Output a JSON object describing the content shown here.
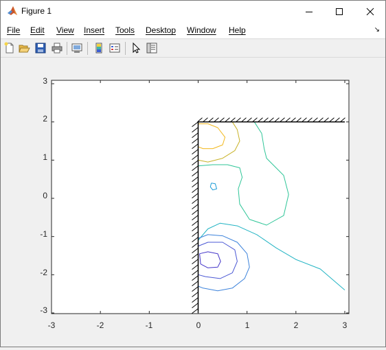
{
  "window": {
    "title": "Figure 1",
    "controls": [
      "minimize",
      "maximize",
      "close"
    ]
  },
  "menu": {
    "items": [
      "File",
      "Edit",
      "View",
      "Insert",
      "Tools",
      "Desktop",
      "Window",
      "Help"
    ]
  },
  "toolbar": {
    "icons": [
      "new-figure-icon",
      "open-file-icon",
      "save-icon",
      "print-icon",
      "link-plot-icon",
      "insert-colorbar-icon",
      "insert-legend-icon",
      "edit-plot-icon",
      "property-inspector-icon"
    ]
  },
  "chart_data": {
    "type": "contour",
    "title": "",
    "xlabel": "",
    "ylabel": "",
    "xlim": [
      -3,
      3
    ],
    "ylim": [
      -3,
      3
    ],
    "xticks": [
      "-3",
      "-2",
      "-1",
      "0",
      "1",
      "2",
      "3"
    ],
    "yticks": [
      "3",
      "2",
      "1",
      "0",
      "-1",
      "-2",
      "-3"
    ],
    "grid": false,
    "walls": [
      {
        "name": "left-wall",
        "x": [
          0,
          0
        ],
        "y": [
          -3,
          2
        ]
      },
      {
        "name": "top-wall",
        "x": [
          0,
          3
        ],
        "y": [
          2,
          2
        ]
      }
    ],
    "contours": [
      {
        "name": "positive-inner",
        "color": "#f2b81b",
        "x": [
          0,
          0.2,
          0.4,
          0.55,
          0.5,
          0.3,
          0.1,
          0
        ],
        "y": [
          1.95,
          1.95,
          1.85,
          1.6,
          1.4,
          1.3,
          1.3,
          1.35
        ]
      },
      {
        "name": "positive-outer",
        "color": "#c8b227",
        "x": [
          0.7,
          0.8,
          0.85,
          0.75,
          0.5,
          0.2,
          0
        ],
        "y": [
          2,
          1.8,
          1.5,
          1.25,
          1.05,
          0.95,
          1.0
        ]
      },
      {
        "name": "zero-level",
        "color": "#2dc597",
        "x": [
          1.15,
          1.3,
          1.35,
          1.4,
          1.75,
          1.85,
          1.75,
          1.4,
          1.05,
          0.85,
          0.82,
          0.9,
          0.85,
          0.6,
          0.3,
          0
        ],
        "y": [
          2,
          1.7,
          1.3,
          1.05,
          0.6,
          0.1,
          -0.45,
          -0.7,
          -0.55,
          -0.15,
          0.25,
          0.55,
          0.8,
          0.88,
          0.88,
          0.85
        ]
      },
      {
        "name": "island",
        "color": "#1a9bd6",
        "x": [
          0.27,
          0.35,
          0.38,
          0.3,
          0.25,
          0.27
        ],
        "y": [
          0.4,
          0.38,
          0.25,
          0.22,
          0.3,
          0.4
        ]
      },
      {
        "name": "negative-long",
        "color": "#20b3c3",
        "x": [
          0,
          0.2,
          0.45,
          0.8,
          1.2,
          1.6,
          2.0,
          2.5,
          3.0
        ],
        "y": [
          -1.1,
          -0.8,
          -0.65,
          -0.72,
          -0.95,
          -1.3,
          -1.6,
          -1.85,
          -2.4
        ]
      },
      {
        "name": "negative-outer",
        "color": "#3b82db",
        "x": [
          0,
          0.2,
          0.5,
          0.8,
          1.0,
          1.05,
          0.95,
          0.7,
          0.4,
          0.1,
          0
        ],
        "y": [
          -1.05,
          -0.95,
          -0.98,
          -1.15,
          -1.45,
          -1.8,
          -2.1,
          -2.35,
          -2.42,
          -2.35,
          -2.3
        ]
      },
      {
        "name": "negative-mid",
        "color": "#4a57d4",
        "x": [
          0,
          0.2,
          0.5,
          0.75,
          0.8,
          0.7,
          0.45,
          0.15,
          0
        ],
        "y": [
          -1.25,
          -1.15,
          -1.15,
          -1.35,
          -1.65,
          -1.95,
          -2.1,
          -2.05,
          -2.0
        ]
      },
      {
        "name": "negative-inner",
        "color": "#4233c8",
        "x": [
          0.03,
          0.2,
          0.4,
          0.46,
          0.4,
          0.2,
          0.05,
          0.03
        ],
        "y": [
          -1.45,
          -1.4,
          -1.45,
          -1.65,
          -1.8,
          -1.82,
          -1.72,
          -1.45
        ]
      }
    ]
  }
}
